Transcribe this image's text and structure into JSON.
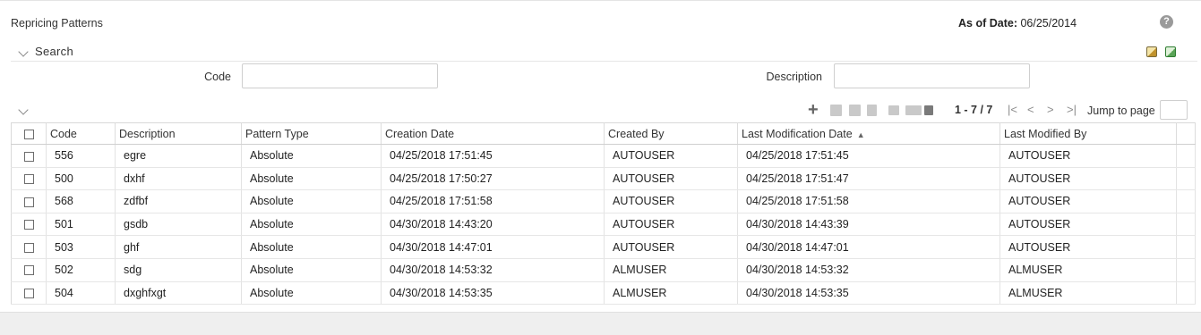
{
  "header": {
    "title": "Repricing Patterns",
    "as_of_label": "As of Date:",
    "as_of_value": "06/25/2014"
  },
  "icons": {
    "help": "?",
    "add": "+",
    "sort_asc": "▲",
    "first_page": "|<",
    "prev_page": "<",
    "next_page": ">",
    "last_page": ">|"
  },
  "search": {
    "label": "Search",
    "code_label": "Code",
    "code_value": "",
    "description_label": "Description",
    "description_value": ""
  },
  "pager": {
    "range": "1 - 7 / 7",
    "jump_label": "Jump to page",
    "jump_value": ""
  },
  "table": {
    "columns": [
      "Code",
      "Description",
      "Pattern Type",
      "Creation Date",
      "Created By",
      "Last Modification Date",
      "Last Modified By"
    ],
    "rows": [
      {
        "code": "556",
        "description": "egre",
        "pattern_type": "Absolute",
        "creation_date": "04/25/2018 17:51:45",
        "created_by": "AUTOUSER",
        "last_mod_date": "04/25/2018 17:51:45",
        "last_mod_by": "AUTOUSER"
      },
      {
        "code": "500",
        "description": "dxhf",
        "pattern_type": "Absolute",
        "creation_date": "04/25/2018 17:50:27",
        "created_by": "AUTOUSER",
        "last_mod_date": "04/25/2018 17:51:47",
        "last_mod_by": "AUTOUSER"
      },
      {
        "code": "568",
        "description": "zdfbf",
        "pattern_type": "Absolute",
        "creation_date": "04/25/2018 17:51:58",
        "created_by": "AUTOUSER",
        "last_mod_date": "04/25/2018 17:51:58",
        "last_mod_by": "AUTOUSER"
      },
      {
        "code": "501",
        "description": "gsdb",
        "pattern_type": "Absolute",
        "creation_date": "04/30/2018 14:43:20",
        "created_by": "AUTOUSER",
        "last_mod_date": "04/30/2018 14:43:39",
        "last_mod_by": "AUTOUSER"
      },
      {
        "code": "503",
        "description": "ghf",
        "pattern_type": "Absolute",
        "creation_date": "04/30/2018 14:47:01",
        "created_by": "AUTOUSER",
        "last_mod_date": "04/30/2018 14:47:01",
        "last_mod_by": "AUTOUSER"
      },
      {
        "code": "502",
        "description": "sdg",
        "pattern_type": "Absolute",
        "creation_date": "04/30/2018 14:53:32",
        "created_by": "ALMUSER",
        "last_mod_date": "04/30/2018 14:53:32",
        "last_mod_by": "ALMUSER"
      },
      {
        "code": "504",
        "description": "dxghfxgt",
        "pattern_type": "Absolute",
        "creation_date": "04/30/2018 14:53:35",
        "created_by": "ALMUSER",
        "last_mod_date": "04/30/2018 14:53:35",
        "last_mod_by": "ALMUSER"
      }
    ]
  }
}
